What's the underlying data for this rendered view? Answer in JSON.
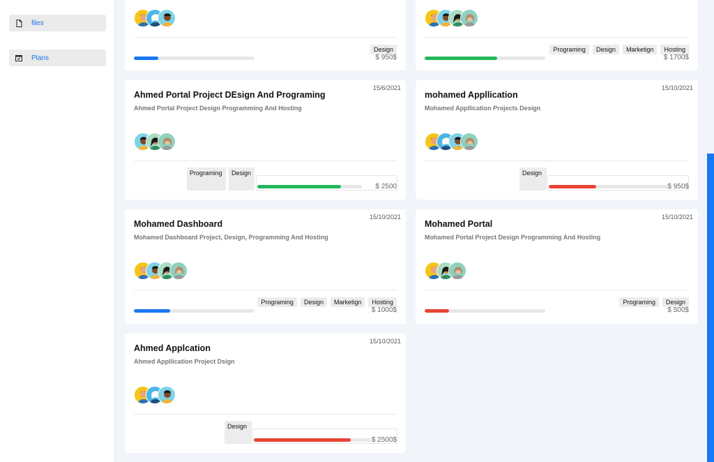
{
  "sidebar": {
    "items": [
      {
        "label": "files",
        "icon": "file-icon"
      },
      {
        "label": "Plans",
        "icon": "calendar-icon"
      }
    ]
  },
  "colors": {
    "accent": "#1877f2",
    "blue": "#1877f2",
    "green": "#22b65a",
    "red": "#ea4335"
  },
  "cards": [
    {
      "title": "",
      "date": "",
      "desc": "",
      "tags": [
        "Design"
      ],
      "price": "$ 950$",
      "progress": 0.2,
      "progress_color": "blue"
    },
    {
      "title": "",
      "date": "",
      "desc": "",
      "tags": [
        "Programing",
        "Design",
        "Marketign",
        "Hosting"
      ],
      "price": "$ 1700$",
      "progress": 0.6,
      "progress_color": "green"
    },
    {
      "title": "Ahmed Portal Project DEsign And Programing",
      "date": "15/6/2021",
      "desc": "Ahmed Portal Project Design Programming And Hosting",
      "tags": [
        "Programing",
        "Design"
      ],
      "price": "$ 2500",
      "progress": 0.8,
      "progress_color": "green"
    },
    {
      "title": "mohamed Appllication",
      "date": "15/10/2021",
      "desc": "Mohamed Appllication Projects Design",
      "tags": [
        "Design"
      ],
      "price": "$ 950$",
      "progress": 0.4,
      "progress_color": "red"
    },
    {
      "title": "Mohamed Dashboard",
      "date": "15/10/2021",
      "desc": "Mohamed Dashboard Project, Design, Programming And Hosting",
      "tags": [
        "Programing",
        "Design",
        "Marketign",
        "Hosting"
      ],
      "price": "$ 1000$",
      "progress": 0.3,
      "progress_color": "blue"
    },
    {
      "title": "Mohamed Portal",
      "date": "15/10/2021",
      "desc": "Mohamed Portal Project Design Programming And Hosting",
      "tags": [
        "Programing",
        "Design"
      ],
      "price": "$ 500$",
      "progress": 0.2,
      "progress_color": "red"
    },
    {
      "title": "Ahmed Applcation",
      "date": "15/10/2021",
      "desc": "Ahmed Appllication Project Dsign",
      "tags": [
        "Design"
      ],
      "price": "$ 2500$",
      "progress": 0.83,
      "progress_color": "red"
    }
  ]
}
